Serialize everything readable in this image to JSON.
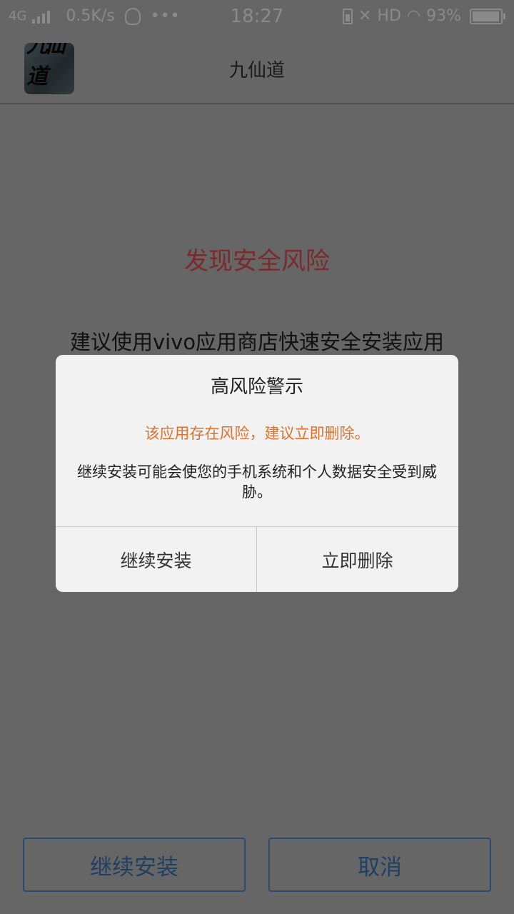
{
  "status_bar": {
    "network": "4G",
    "speed": "0.5K/s",
    "more": "•••",
    "time": "18:27",
    "hd": "HD",
    "battery": "93%",
    "icons": [
      "signal-icon",
      "qq-icon",
      "battery-charging-icon",
      "mute-icon",
      "wifi-icon",
      "battery-icon"
    ]
  },
  "header": {
    "app_icon_text": "九仙道",
    "title": "九仙道"
  },
  "page": {
    "risk_title": "发现安全风险",
    "suggestion": "建议使用vivo应用商店快速安全安装应用"
  },
  "dialog": {
    "title": "高风险警示",
    "warning": "该应用存在风险，建议立即删除。",
    "body": "继续安装可能会使您的手机系统和个人数据安全受到威胁。",
    "continue_label": "继续安装",
    "delete_label": "立即删除"
  },
  "bottom": {
    "continue_label": "继续安装",
    "cancel_label": "取消"
  },
  "colors": {
    "overlay_bg": "#666666",
    "risk_title": "#7a2a2a",
    "warning_text": "#e2712d",
    "bottom_button": "#26496e"
  }
}
